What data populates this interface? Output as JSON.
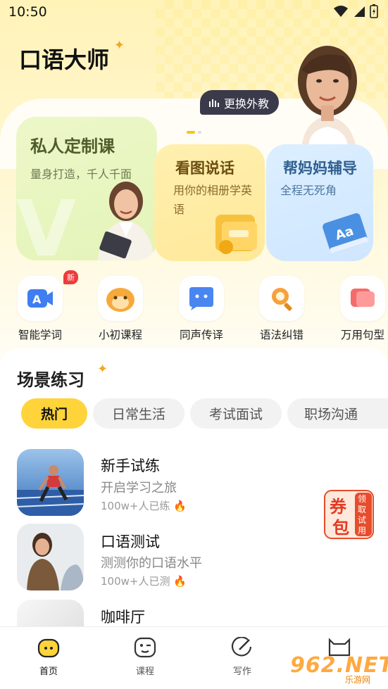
{
  "status": {
    "time": "10:50"
  },
  "header": {
    "title": "口语大师",
    "switch_label": "更换外教"
  },
  "cards": [
    {
      "title": "私人定制课",
      "subtitle": "量身打造，千人千面"
    },
    {
      "title": "看图说话",
      "subtitle": "用你的相册学英语"
    },
    {
      "title": "帮妈妈辅导",
      "subtitle": "全程无死角"
    }
  ],
  "functions": [
    {
      "label": "智能学词",
      "icon": "ai-word-icon",
      "badge": "新"
    },
    {
      "label": "小初课程",
      "icon": "mascot-icon"
    },
    {
      "label": "同声传译",
      "icon": "interpret-icon"
    },
    {
      "label": "语法纠错",
      "icon": "grammar-search-icon"
    },
    {
      "label": "万用句型",
      "icon": "sentence-icon"
    }
  ],
  "scene": {
    "title": "场景练习",
    "tabs": [
      "热门",
      "日常生活",
      "考试面试",
      "职场沟通"
    ],
    "items": [
      {
        "title": "新手试练",
        "subtitle": "开启学习之旅",
        "meta": "100w+人已练"
      },
      {
        "title": "口语测试",
        "subtitle": "测测你的口语水平",
        "meta": "100w+人已测"
      },
      {
        "title": "咖啡厅",
        "subtitle": "",
        "meta": ""
      }
    ]
  },
  "coupon": {
    "big1": "券",
    "big2": "包",
    "side": "领取试用"
  },
  "nav": [
    {
      "label": "首页"
    },
    {
      "label": "课程"
    },
    {
      "label": "写作"
    },
    {
      "label": ""
    }
  ],
  "watermark": {
    "main": "962.NET",
    "sub": "乐游网"
  },
  "colors": {
    "accent": "#ffd43b",
    "dark": "#3a3a4a",
    "new_badge": "#ef3b3b"
  }
}
